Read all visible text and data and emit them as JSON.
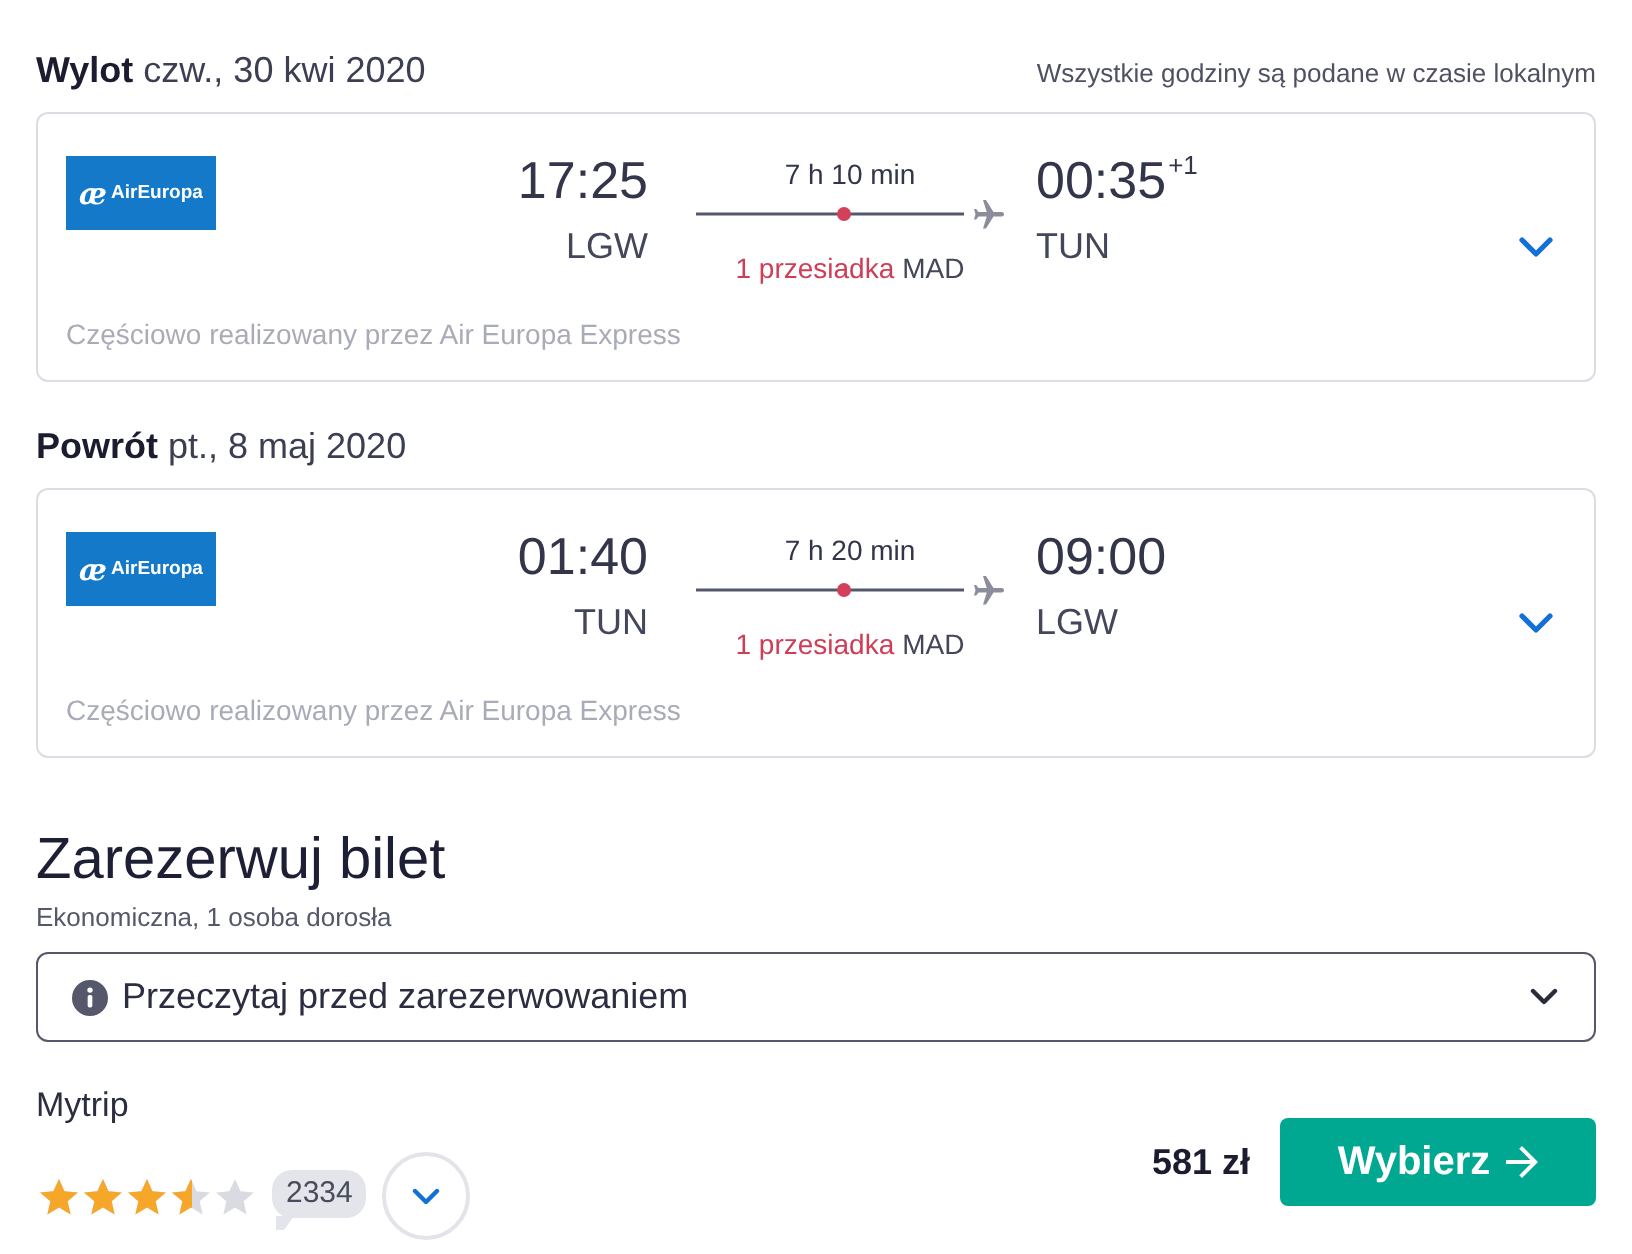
{
  "legs": [
    {
      "label": "Wylot",
      "date": "czw., 30 kwi 2020",
      "note": "Wszystkie godziny są podane w czasie lokalnym",
      "logo": {
        "mark": "æ",
        "name": "AirEuropa"
      },
      "departure": {
        "time": "17:25",
        "airport": "LGW"
      },
      "duration": "7 h 10 min",
      "stops": "1 przesiadka",
      "stop_airport": "MAD",
      "arrival": {
        "time": "00:35",
        "day_offset": "+1",
        "airport": "TUN"
      },
      "expanded": false,
      "operated_by": "Częściowo realizowany przez Air Europa Express"
    },
    {
      "label": "Powrót",
      "date": "pt., 8 maj 2020",
      "logo": {
        "mark": "æ",
        "name": "AirEuropa"
      },
      "departure": {
        "time": "01:40",
        "airport": "TUN"
      },
      "duration": "7 h 20 min",
      "stops": "1 przesiadka",
      "stop_airport": "MAD",
      "arrival": {
        "time": "09:00",
        "airport": "LGW"
      },
      "expanded": false,
      "operated_by": "Częściowo realizowany przez Air Europa Express"
    }
  ],
  "booking": {
    "title": "Zarezerwuj bilet",
    "subtitle": "Ekonomiczna, 1 osoba dorosła",
    "notice": {
      "label": "Przeczytaj przed zarezerwowaniem",
      "expanded": false
    },
    "offer": {
      "provider": "Mytrip",
      "stars": 3.5,
      "reviews": "2334",
      "details_expanded": false,
      "price": "581 zł",
      "button": "Wybierz"
    }
  }
}
